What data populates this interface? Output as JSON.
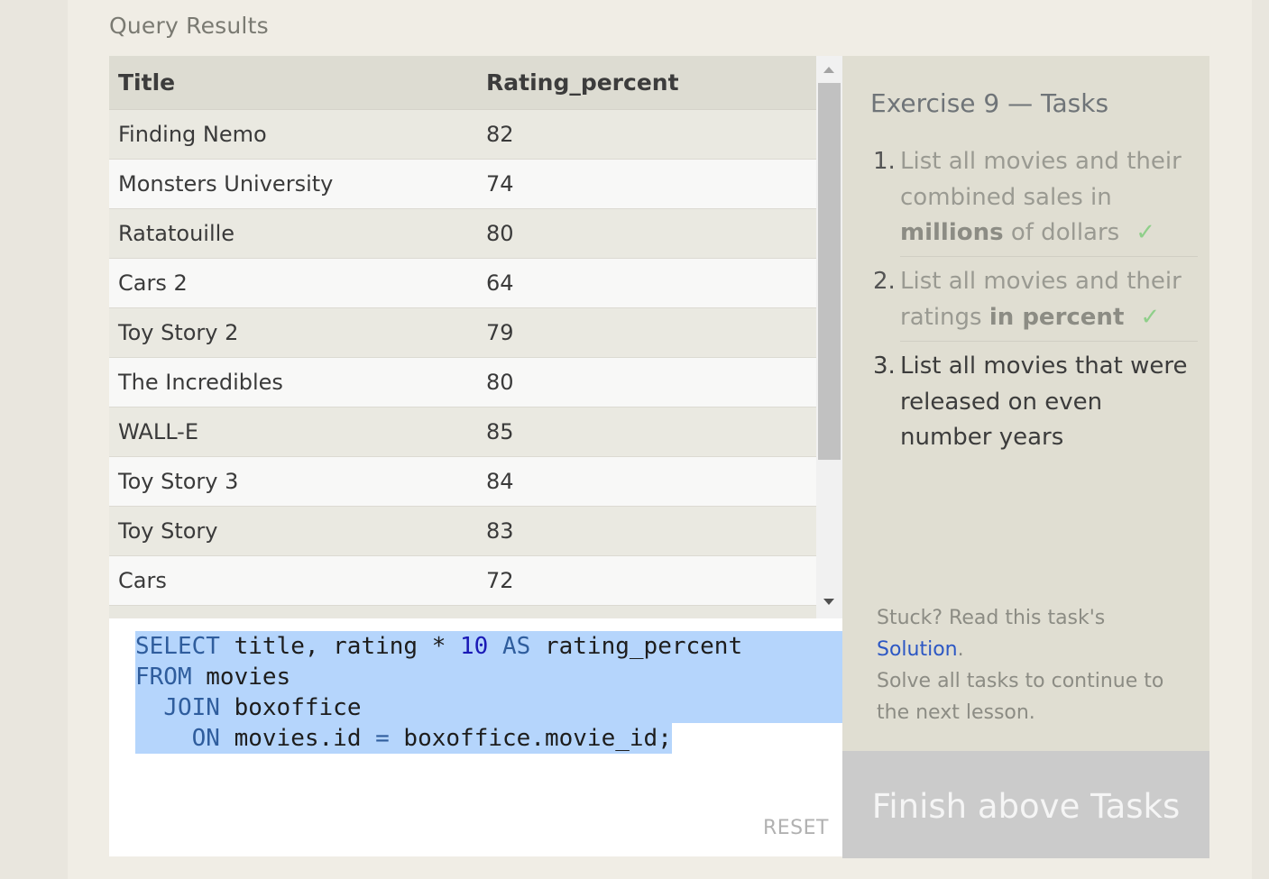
{
  "results": {
    "label": "Query Results",
    "columns": [
      "Title",
      "Rating_percent"
    ],
    "rows": [
      [
        "Finding Nemo",
        "82"
      ],
      [
        "Monsters University",
        "74"
      ],
      [
        "Ratatouille",
        "80"
      ],
      [
        "Cars 2",
        "64"
      ],
      [
        "Toy Story 2",
        "79"
      ],
      [
        "The Incredibles",
        "80"
      ],
      [
        "WALL-E",
        "85"
      ],
      [
        "Toy Story 3",
        "84"
      ],
      [
        "Toy Story",
        "83"
      ],
      [
        "Cars",
        "72"
      ]
    ]
  },
  "editor": {
    "line1": {
      "kw1": "SELECT",
      "t1": " title, rating * ",
      "n1": "10",
      "kw2": "AS",
      "t2": " rating_percent"
    },
    "line2": {
      "kw1": "FROM",
      "t1": " movies"
    },
    "line3": {
      "indent": "  ",
      "kw1": "JOIN",
      "t1": " boxoffice"
    },
    "line4": {
      "indent": "    ",
      "kw1": "ON",
      "t1": " movies.id ",
      "op": "=",
      "t2": " boxoffice.movie_id;"
    },
    "reset_label": "RESET"
  },
  "tasks": {
    "title": "Exercise 9 — Tasks",
    "items": [
      {
        "number": "1.",
        "pre": "List all movies and their combined sales in ",
        "bold": "millions",
        "post": " of dollars",
        "check": "✓",
        "status": "done"
      },
      {
        "number": "2.",
        "pre": "List all movies and their ratings ",
        "bold": "in percent",
        "post": "",
        "check": "✓",
        "status": "done"
      },
      {
        "number": "3.",
        "text": "List all movies that were released on even number years",
        "status": "current"
      }
    ],
    "stuck_prefix": "Stuck? Read this task's ",
    "solution_link": "Solution",
    "stuck_suffix": ".",
    "continue_text": "Solve all tasks to continue to the next lesson.",
    "finish_button": "Finish above Tasks"
  },
  "colors": {
    "keyword": "#2f5d9d",
    "number": "#1a1ab6",
    "selection": "#b5d5fc",
    "check": "#8fcf8a",
    "link": "#2c57c4",
    "finish_button_bg": "#cbcbcb"
  }
}
